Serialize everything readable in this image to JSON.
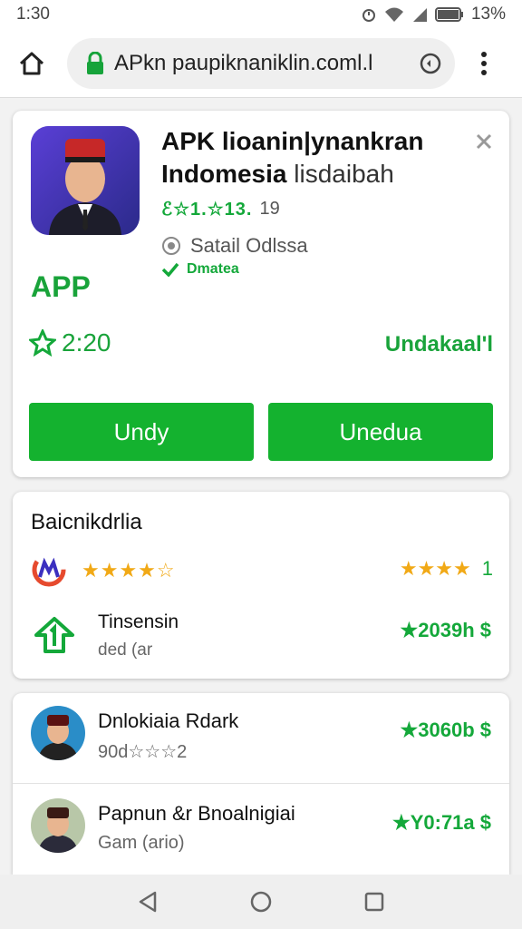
{
  "status_bar": {
    "time": "1:30",
    "battery": "13%"
  },
  "browser": {
    "url": "APkn paupiknaniklin.coml.l"
  },
  "app_card": {
    "title": "APK lioanin|ynankran",
    "title_bold_line2": "Indomesia",
    "title_sub": "lisdaibah",
    "rating_stars_text": "ℰ☆1.☆13.",
    "rating_count": "19",
    "status_label": "Satail Odlssa",
    "verified_label": "Dmatea",
    "app_tag": "APP",
    "count": "2:20",
    "right_link": "Undakaal'l",
    "button_left": "Undy",
    "button_right": "Unedua"
  },
  "section1": {
    "title": "Baicnikdrlia",
    "row1_stars": "★★★★☆",
    "row1_right_stars": "★★★★",
    "row1_right_count": "1",
    "row2_title": "Tinsensin",
    "row2_sub": "ded (ar",
    "row2_price": "★2039h $"
  },
  "section2": {
    "items": [
      {
        "title": "Dnlokiaia Rdark",
        "sub": "90d☆☆☆2",
        "price": "★3060b $"
      },
      {
        "title": "Papnun &r Bnoalnigiai",
        "sub": "Gam (ario)",
        "price": "★Y0:71a $"
      }
    ]
  },
  "colors": {
    "accent_green": "#14b22f",
    "text_green": "#14a83a",
    "star_gold": "#f1a916"
  },
  "icons": [
    "home-icon",
    "lock-icon",
    "refresh-icon",
    "overflow-menu-icon",
    "close-icon",
    "star-icon",
    "check-icon",
    "back-icon",
    "home-nav-icon",
    "recents-icon"
  ]
}
